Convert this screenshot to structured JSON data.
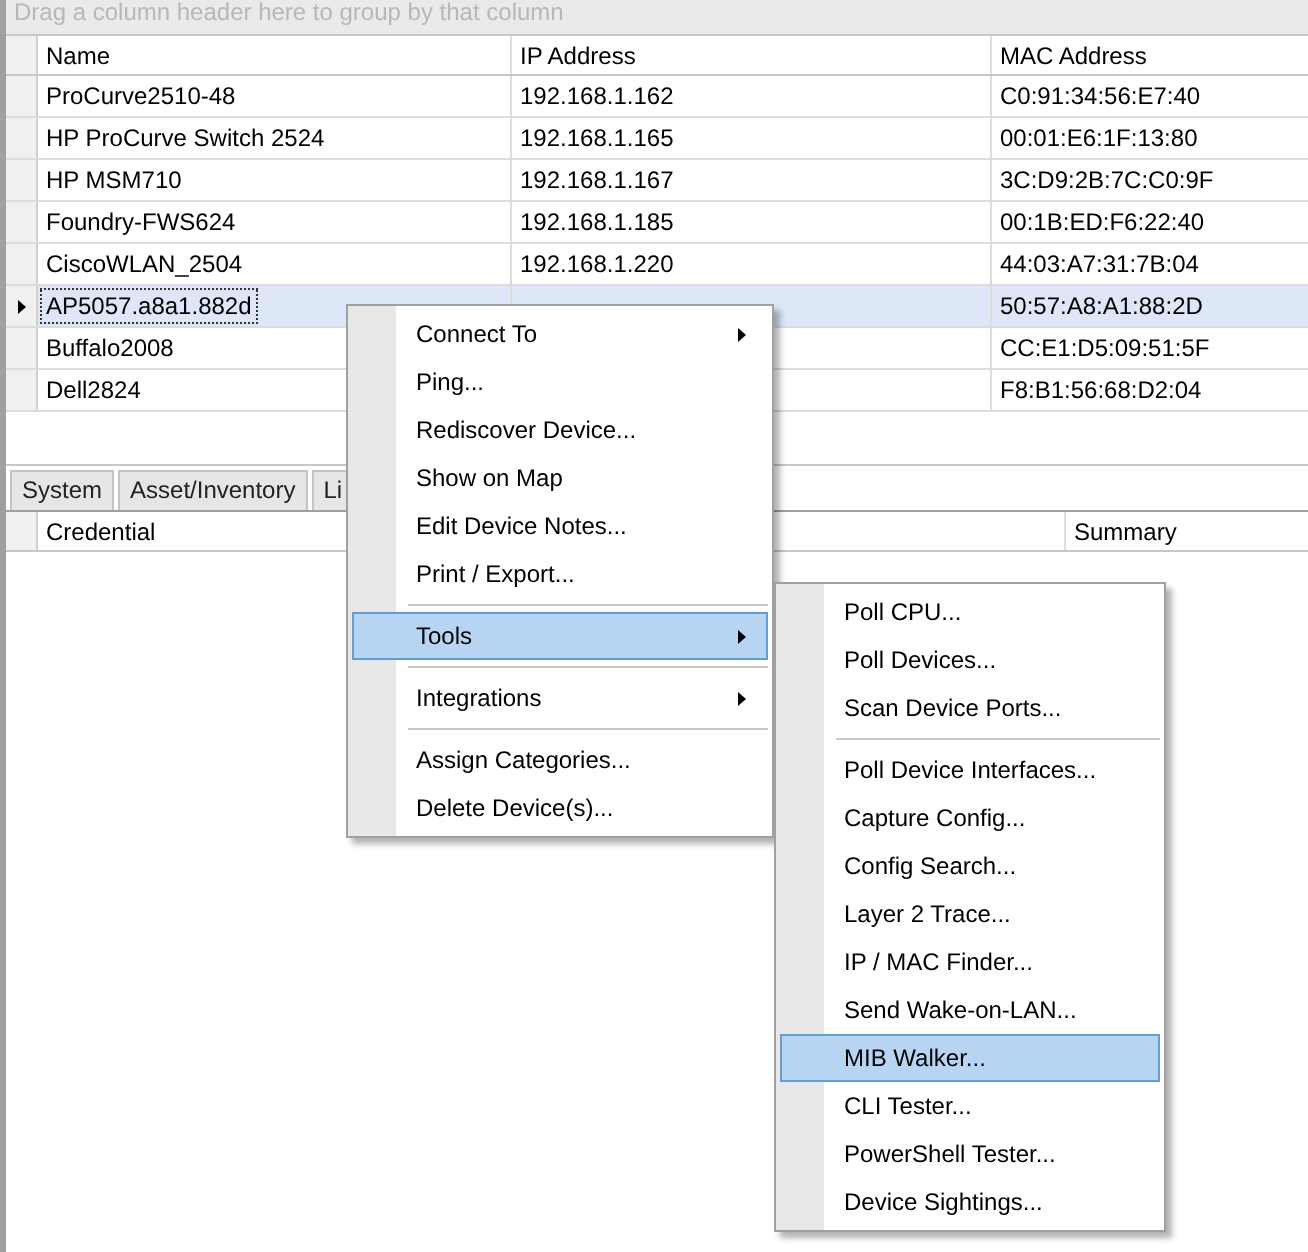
{
  "group_panel": {
    "placeholder": "Drag a column header here to group by that column"
  },
  "grid": {
    "columns": [
      "Name",
      "IP Address",
      "MAC Address"
    ],
    "rows": [
      {
        "name": "ProCurve2510-48",
        "ip": "192.168.1.162",
        "mac": "C0:91:34:56:E7:40",
        "selected": false
      },
      {
        "name": "HP ProCurve Switch 2524",
        "ip": "192.168.1.165",
        "mac": "00:01:E6:1F:13:80",
        "selected": false
      },
      {
        "name": "HP MSM710",
        "ip": "192.168.1.167",
        "mac": "3C:D9:2B:7C:C0:9F",
        "selected": false
      },
      {
        "name": "Foundry-FWS624",
        "ip": "192.168.1.185",
        "mac": "00:1B:ED:F6:22:40",
        "selected": false
      },
      {
        "name": "CiscoWLAN_2504",
        "ip": "192.168.1.220",
        "mac": "44:03:A7:31:7B:04",
        "selected": false
      },
      {
        "name": "AP5057.a8a1.882d",
        "mac": "50:57:A8:A1:88:2D",
        "selected": true
      },
      {
        "name": "Buffalo2008",
        "mac": "CC:E1:D5:09:51:5F",
        "selected": false
      },
      {
        "name": "Dell2824",
        "mac": "F8:B1:56:68:D2:04",
        "selected": false
      }
    ]
  },
  "tabs": [
    {
      "label": "System",
      "selected": false
    },
    {
      "label": "Asset/Inventory",
      "selected": false
    },
    {
      "label": "Li",
      "selected": false
    }
  ],
  "detail_grid": {
    "columns": [
      "Credential",
      "Summary"
    ]
  },
  "context_menu": {
    "items": [
      {
        "kind": "item",
        "label": "Connect To",
        "submenu": true,
        "highlighted": false
      },
      {
        "kind": "item",
        "label": "Ping...",
        "submenu": false,
        "highlighted": false
      },
      {
        "kind": "item",
        "label": "Rediscover Device...",
        "submenu": false,
        "highlighted": false
      },
      {
        "kind": "item",
        "label": "Show on Map",
        "submenu": false,
        "highlighted": false
      },
      {
        "kind": "item",
        "label": "Edit Device Notes...",
        "submenu": false,
        "highlighted": false
      },
      {
        "kind": "item",
        "label": "Print / Export...",
        "submenu": false,
        "highlighted": false
      },
      {
        "kind": "separator"
      },
      {
        "kind": "item",
        "label": "Tools",
        "submenu": true,
        "highlighted": true
      },
      {
        "kind": "separator"
      },
      {
        "kind": "item",
        "label": "Integrations",
        "submenu": true,
        "highlighted": false
      },
      {
        "kind": "separator"
      },
      {
        "kind": "item",
        "label": "Assign Categories...",
        "submenu": false,
        "highlighted": false
      },
      {
        "kind": "item",
        "label": "Delete Device(s)...",
        "submenu": false,
        "highlighted": false
      }
    ]
  },
  "submenu": {
    "items": [
      {
        "kind": "item",
        "label": "Poll CPU...",
        "submenu": false,
        "highlighted": false
      },
      {
        "kind": "item",
        "label": "Poll Devices...",
        "submenu": false,
        "highlighted": false
      },
      {
        "kind": "item",
        "label": "Scan Device Ports...",
        "submenu": false,
        "highlighted": false
      },
      {
        "kind": "separator"
      },
      {
        "kind": "item",
        "label": "Poll Device Interfaces...",
        "submenu": false,
        "highlighted": false
      },
      {
        "kind": "item",
        "label": "Capture Config...",
        "submenu": false,
        "highlighted": false
      },
      {
        "kind": "item",
        "label": "Config Search...",
        "submenu": false,
        "highlighted": false
      },
      {
        "kind": "item",
        "label": "Layer 2 Trace...",
        "submenu": false,
        "highlighted": false
      },
      {
        "kind": "item",
        "label": "IP / MAC Finder...",
        "submenu": false,
        "highlighted": false
      },
      {
        "kind": "item",
        "label": "Send Wake-on-LAN...",
        "submenu": false,
        "highlighted": false
      },
      {
        "kind": "item",
        "label": "MIB Walker...",
        "submenu": false,
        "highlighted": true
      },
      {
        "kind": "item",
        "label": "CLI Tester...",
        "submenu": false,
        "highlighted": false
      },
      {
        "kind": "item",
        "label": "PowerShell Tester...",
        "submenu": false,
        "highlighted": false
      },
      {
        "kind": "item",
        "label": "Device Sightings...",
        "submenu": false,
        "highlighted": false
      }
    ]
  }
}
